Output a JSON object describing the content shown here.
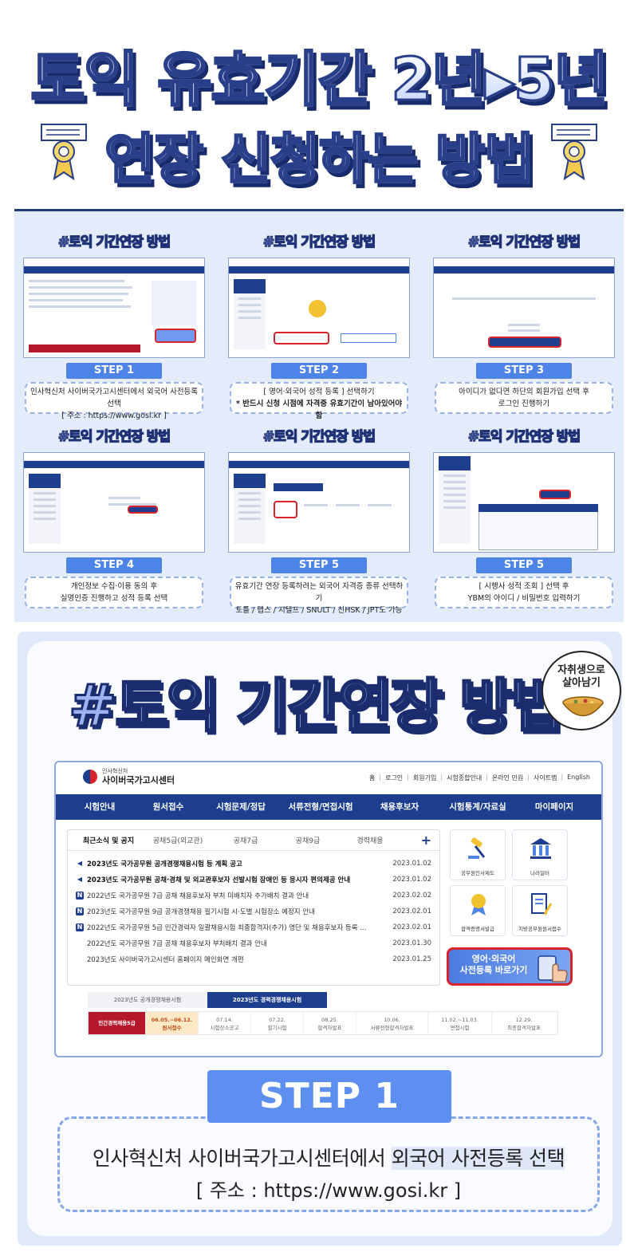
{
  "header": {
    "title_line1": "토익 유효기간 2년▸5년",
    "title_line2": "연장 신청하는 방법"
  },
  "grid_tag": "#토익 기간연장 방법",
  "steps": [
    {
      "label": "STEP 1",
      "line1": "인사혁신처 사이버국가고시센터에서 외국어 사전등록 선택",
      "line2": "[ 주소 : https://www.gosi.kr ]"
    },
    {
      "label": "STEP 2",
      "line1": "[ 영어·외국어 성적 등록 ] 선택하기",
      "line2": "* 반드시 신청 시점에 자격증 유효기간이 남아있어야 함"
    },
    {
      "label": "STEP 3",
      "line1": "아이디가 없다면 하단의 회원가입 선택 후",
      "line2": "로그인 진행하기"
    },
    {
      "label": "STEP 4",
      "line1": "개인정보 수집·이용 동의 후",
      "line2": "실명인증 진행하고 성적 등록 선택"
    },
    {
      "label": "STEP 5",
      "line1": "유효기간 연장 등록하려는 외국어 자격증 종류 선택하기",
      "line2": "토플 / 텝스 / 지텔프 / SNULT / 신HSK / JPT도 가능"
    },
    {
      "label": "STEP 5",
      "line1": "[ 시행사 성적 조회 ] 선택 후",
      "line2": "YBM의 아이디 / 비밀번호 입력하기"
    }
  ],
  "big": {
    "tag": "#토익 기간연장 방법",
    "sticker_line1": "자취생으로",
    "sticker_line2": "살아남기",
    "step_label": "STEP 1",
    "desc_line1_a": "인사혁신처 사이버국가고시센터에서 ",
    "desc_line1_b": "외국어 사전등록 선택",
    "desc_line2": "[ 주소 : https://www.gosi.kr ]"
  },
  "site": {
    "logo_small": "인사혁신처",
    "logo_main": "사이버국가고시센터",
    "toplinks": [
      "홈",
      "로그인",
      "회원가입",
      "시험종합안내",
      "온라인 민원",
      "사이트맵",
      "English"
    ],
    "nav": [
      "시험안내",
      "원서접수",
      "시험문제/정답",
      "서류전형/면접시험",
      "채용후보자",
      "시험통계/자료실",
      "마이페이지"
    ],
    "tabs": [
      "최근소식 및 공지",
      "공채5급(외교관)",
      "공채7급",
      "공채9급",
      "경력채용"
    ],
    "news": [
      {
        "icon": "spk",
        "bold": true,
        "title": "2023년도 국가공무원 공개경쟁채용시험 등 계획 공고",
        "date": "2023.01.02"
      },
      {
        "icon": "spk",
        "bold": true,
        "title": "2023년도 국가공무원 공채·경채 및 외교관후보자 선발시험 장애인 등 응시자 편의제공 안내",
        "date": "2023.01.02"
      },
      {
        "icon": "n",
        "bold": false,
        "title": "2022년도 국가공무원 7급 공채 채용후보자 부처 미배치자 추가배치 결과 안내",
        "date": "2023.02.02"
      },
      {
        "icon": "n",
        "bold": false,
        "title": "2023년도 국가공무원 9급 공개경쟁채용 필기시험 시·도별 시험장소 예정지 안내",
        "date": "2023.02.01"
      },
      {
        "icon": "n",
        "bold": false,
        "title": "2022년도 국가공무원 5급 민간경력자 일괄채용시험 최종합격자(추가) 명단 및 채용후보자 등록 ...",
        "date": "2023.02.01"
      },
      {
        "icon": "none",
        "bold": false,
        "title": "2022년도 국가공무원 7급 공채 채용후보자 부처배치 결과 안내",
        "date": "2023.01.30"
      },
      {
        "icon": "none",
        "bold": false,
        "title": "2023년도 사이버국가고시센터 홈페이지 메인화면 개편",
        "date": "2023.01.25"
      }
    ],
    "quick": [
      "공무원인사제도",
      "나라일터",
      "합격증명서발급",
      "지방공무원원서접수"
    ],
    "lang_button": {
      "line1": "영어·외국어",
      "line2": "사전등록 바로가기"
    },
    "sched_tabs": [
      "2023년도 공개경쟁채용시험",
      "2023년도 경력경쟁채용시험"
    ],
    "sched_first": "민간경력채용5급",
    "sched": [
      {
        "date": "06.05.~06.12.",
        "name": "원서접수",
        "hl": true
      },
      {
        "date": "07.14.",
        "name": "시험장소공고",
        "hl": false
      },
      {
        "date": "07.22.",
        "name": "필기시험",
        "hl": false
      },
      {
        "date": "08.25.",
        "name": "합격자발표",
        "hl": false
      },
      {
        "date": "10.06.",
        "name": "서류전형합격자발표",
        "hl": false
      },
      {
        "date": "11.02.~11.03.",
        "name": "면접시험",
        "hl": false
      },
      {
        "date": "12.29.",
        "name": "최종합격자발표",
        "hl": false
      }
    ]
  },
  "colors": {
    "accent": "#4e84e8",
    "navy": "#1d3e8f",
    "red": "#d9232e"
  }
}
